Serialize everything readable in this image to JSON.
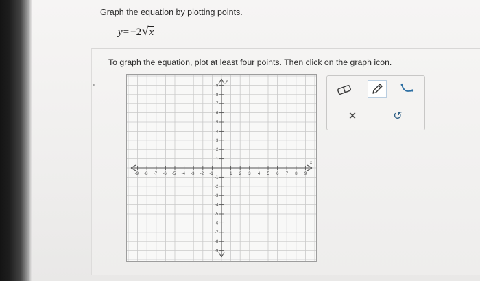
{
  "question": {
    "prompt": "Graph the equation by plotting points.",
    "equation": {
      "lhs": "y",
      "eq": "=",
      "coef": "−2",
      "radical": "√",
      "radicand": "x"
    },
    "instruction": "To graph the equation, plot at least four points. Then click on the graph icon."
  },
  "graph": {
    "x_axis_label": "x",
    "y_axis_label": "y",
    "x_ticks_neg": [
      "-9",
      "-8",
      "-7",
      "-6",
      "-5",
      "-4",
      "-3",
      "-2",
      "-1"
    ],
    "x_ticks_pos": [
      "1",
      "2",
      "3",
      "4",
      "5",
      "6",
      "7",
      "8",
      "9"
    ],
    "y_ticks_pos": [
      "9",
      "8",
      "7",
      "6",
      "5",
      "4",
      "3",
      "2",
      "1"
    ],
    "y_ticks_neg": [
      "-1",
      "-2",
      "-3",
      "-4",
      "-5",
      "-6",
      "-7",
      "-8",
      "-9"
    ],
    "range": [
      -10,
      10
    ]
  },
  "toolbar": {
    "tools": [
      {
        "name": "eraser-icon"
      },
      {
        "name": "pencil-icon"
      },
      {
        "name": "curve-graph-icon"
      }
    ],
    "actions": [
      {
        "name": "clear-icon",
        "glyph": "✕"
      },
      {
        "name": "undo-icon",
        "glyph": "↺"
      }
    ]
  },
  "colors": {
    "accent": "#3a6f98",
    "grid": "#c9c9c9",
    "axis": "#555555"
  }
}
